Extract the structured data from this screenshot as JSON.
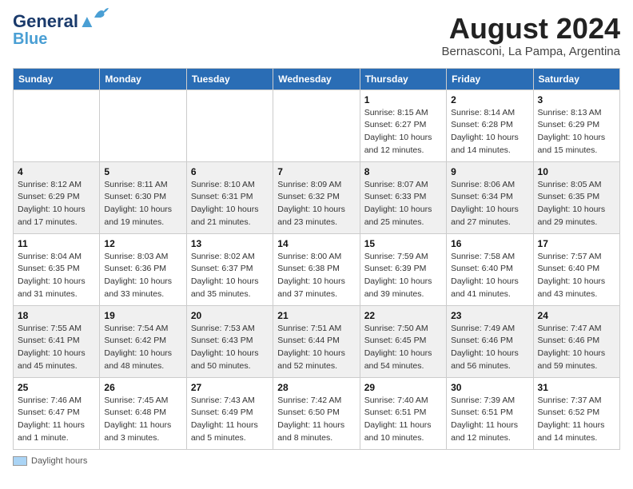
{
  "header": {
    "logo_line1": "General",
    "logo_line2": "Blue",
    "month_title": "August 2024",
    "location": "Bernasconi, La Pampa, Argentina"
  },
  "footer": {
    "daylight_label": "Daylight hours"
  },
  "calendar": {
    "headers": [
      "Sunday",
      "Monday",
      "Tuesday",
      "Wednesday",
      "Thursday",
      "Friday",
      "Saturday"
    ],
    "weeks": [
      [
        {
          "day": "",
          "info": ""
        },
        {
          "day": "",
          "info": ""
        },
        {
          "day": "",
          "info": ""
        },
        {
          "day": "",
          "info": ""
        },
        {
          "day": "1",
          "info": "Sunrise: 8:15 AM\nSunset: 6:27 PM\nDaylight: 10 hours\nand 12 minutes."
        },
        {
          "day": "2",
          "info": "Sunrise: 8:14 AM\nSunset: 6:28 PM\nDaylight: 10 hours\nand 14 minutes."
        },
        {
          "day": "3",
          "info": "Sunrise: 8:13 AM\nSunset: 6:29 PM\nDaylight: 10 hours\nand 15 minutes."
        }
      ],
      [
        {
          "day": "4",
          "info": "Sunrise: 8:12 AM\nSunset: 6:29 PM\nDaylight: 10 hours\nand 17 minutes."
        },
        {
          "day": "5",
          "info": "Sunrise: 8:11 AM\nSunset: 6:30 PM\nDaylight: 10 hours\nand 19 minutes."
        },
        {
          "day": "6",
          "info": "Sunrise: 8:10 AM\nSunset: 6:31 PM\nDaylight: 10 hours\nand 21 minutes."
        },
        {
          "day": "7",
          "info": "Sunrise: 8:09 AM\nSunset: 6:32 PM\nDaylight: 10 hours\nand 23 minutes."
        },
        {
          "day": "8",
          "info": "Sunrise: 8:07 AM\nSunset: 6:33 PM\nDaylight: 10 hours\nand 25 minutes."
        },
        {
          "day": "9",
          "info": "Sunrise: 8:06 AM\nSunset: 6:34 PM\nDaylight: 10 hours\nand 27 minutes."
        },
        {
          "day": "10",
          "info": "Sunrise: 8:05 AM\nSunset: 6:35 PM\nDaylight: 10 hours\nand 29 minutes."
        }
      ],
      [
        {
          "day": "11",
          "info": "Sunrise: 8:04 AM\nSunset: 6:35 PM\nDaylight: 10 hours\nand 31 minutes."
        },
        {
          "day": "12",
          "info": "Sunrise: 8:03 AM\nSunset: 6:36 PM\nDaylight: 10 hours\nand 33 minutes."
        },
        {
          "day": "13",
          "info": "Sunrise: 8:02 AM\nSunset: 6:37 PM\nDaylight: 10 hours\nand 35 minutes."
        },
        {
          "day": "14",
          "info": "Sunrise: 8:00 AM\nSunset: 6:38 PM\nDaylight: 10 hours\nand 37 minutes."
        },
        {
          "day": "15",
          "info": "Sunrise: 7:59 AM\nSunset: 6:39 PM\nDaylight: 10 hours\nand 39 minutes."
        },
        {
          "day": "16",
          "info": "Sunrise: 7:58 AM\nSunset: 6:40 PM\nDaylight: 10 hours\nand 41 minutes."
        },
        {
          "day": "17",
          "info": "Sunrise: 7:57 AM\nSunset: 6:40 PM\nDaylight: 10 hours\nand 43 minutes."
        }
      ],
      [
        {
          "day": "18",
          "info": "Sunrise: 7:55 AM\nSunset: 6:41 PM\nDaylight: 10 hours\nand 45 minutes."
        },
        {
          "day": "19",
          "info": "Sunrise: 7:54 AM\nSunset: 6:42 PM\nDaylight: 10 hours\nand 48 minutes."
        },
        {
          "day": "20",
          "info": "Sunrise: 7:53 AM\nSunset: 6:43 PM\nDaylight: 10 hours\nand 50 minutes."
        },
        {
          "day": "21",
          "info": "Sunrise: 7:51 AM\nSunset: 6:44 PM\nDaylight: 10 hours\nand 52 minutes."
        },
        {
          "day": "22",
          "info": "Sunrise: 7:50 AM\nSunset: 6:45 PM\nDaylight: 10 hours\nand 54 minutes."
        },
        {
          "day": "23",
          "info": "Sunrise: 7:49 AM\nSunset: 6:46 PM\nDaylight: 10 hours\nand 56 minutes."
        },
        {
          "day": "24",
          "info": "Sunrise: 7:47 AM\nSunset: 6:46 PM\nDaylight: 10 hours\nand 59 minutes."
        }
      ],
      [
        {
          "day": "25",
          "info": "Sunrise: 7:46 AM\nSunset: 6:47 PM\nDaylight: 11 hours\nand 1 minute."
        },
        {
          "day": "26",
          "info": "Sunrise: 7:45 AM\nSunset: 6:48 PM\nDaylight: 11 hours\nand 3 minutes."
        },
        {
          "day": "27",
          "info": "Sunrise: 7:43 AM\nSunset: 6:49 PM\nDaylight: 11 hours\nand 5 minutes."
        },
        {
          "day": "28",
          "info": "Sunrise: 7:42 AM\nSunset: 6:50 PM\nDaylight: 11 hours\nand 8 minutes."
        },
        {
          "day": "29",
          "info": "Sunrise: 7:40 AM\nSunset: 6:51 PM\nDaylight: 11 hours\nand 10 minutes."
        },
        {
          "day": "30",
          "info": "Sunrise: 7:39 AM\nSunset: 6:51 PM\nDaylight: 11 hours\nand 12 minutes."
        },
        {
          "day": "31",
          "info": "Sunrise: 7:37 AM\nSunset: 6:52 PM\nDaylight: 11 hours\nand 14 minutes."
        }
      ]
    ]
  }
}
